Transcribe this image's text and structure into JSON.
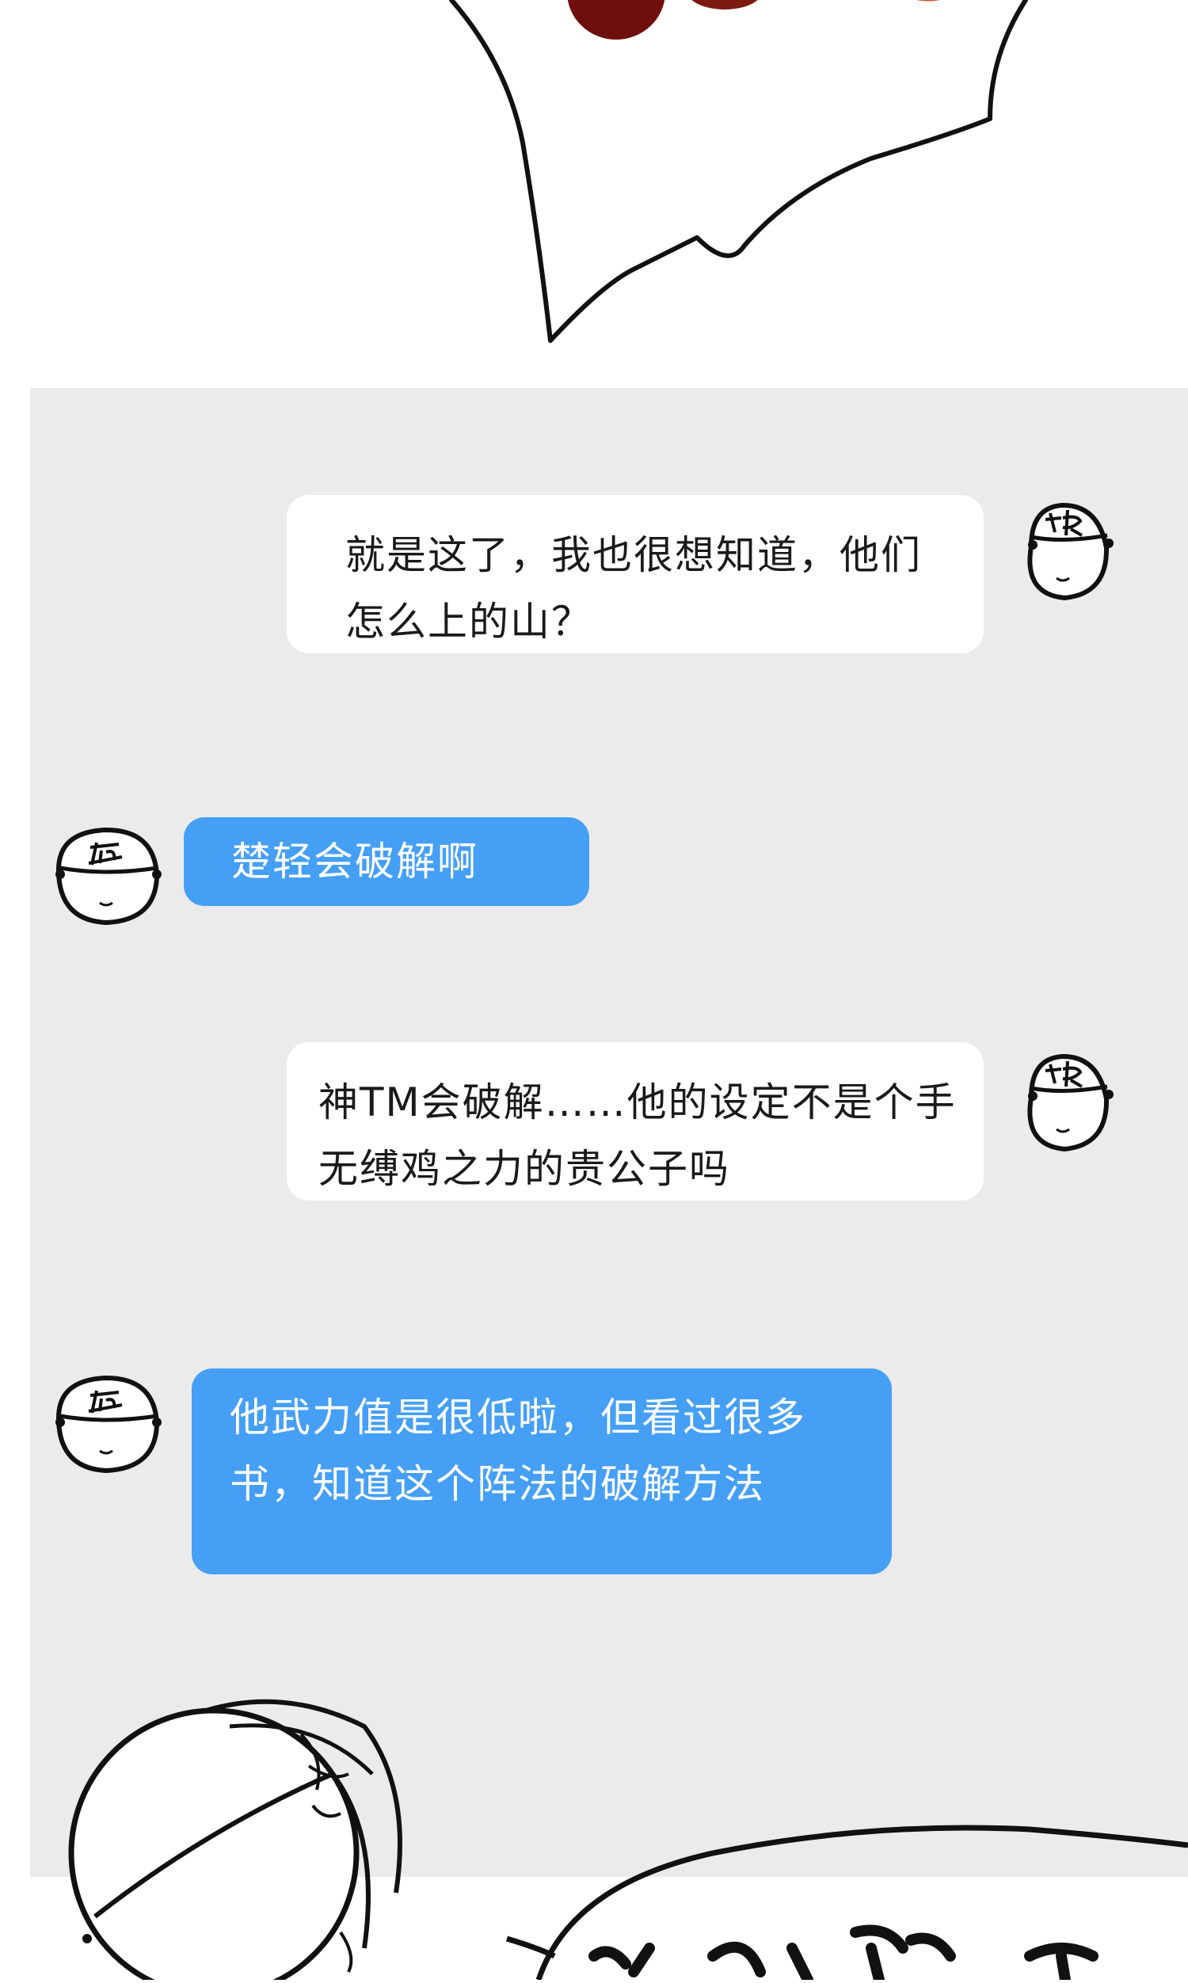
{
  "chat": {
    "messages": [
      {
        "side": "right",
        "color": "white",
        "avatar": "ting-avatar",
        "text": "就是这了，我也很想知道，他们怎么上的山？"
      },
      {
        "side": "left",
        "color": "blue",
        "avatar": "lu-avatar",
        "text": "楚轻会破解啊"
      },
      {
        "side": "right",
        "color": "white",
        "avatar": "ting-avatar",
        "text": "神TM会破解……他的设定不是个手无缚鸡之力的贵公子吗"
      },
      {
        "side": "left",
        "color": "blue",
        "avatar": "lu-avatar",
        "text": "他武力值是很低啦，但看过很多书，知道这个阵法的破解方法"
      }
    ]
  },
  "colors": {
    "chat_background": "#ebebeb",
    "blue_bubble": "#459ff5",
    "white_bubble": "#ffffff",
    "ink": "#111111"
  }
}
